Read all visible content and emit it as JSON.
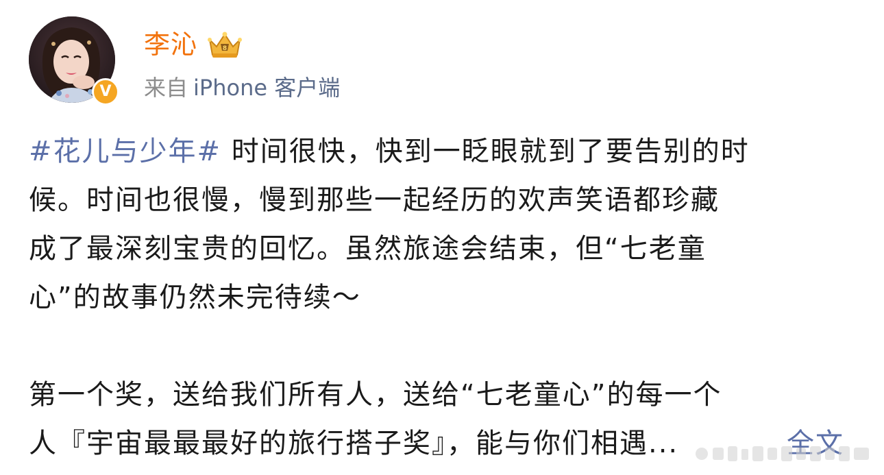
{
  "post": {
    "author": {
      "name": "李沁",
      "badge_icon": "crown-icon",
      "verified_icon": "verified-v-icon",
      "verified_color": "#f5a623",
      "name_color": "#f2720c"
    },
    "source": {
      "prefix": "来自",
      "device": "iPhone 客户端"
    },
    "paragraph1": {
      "hashtag": "#花儿与少年#",
      "line1_rest": " 时间很快，快到一眨眼就到了要告别的时",
      "line2": "候。时间也很慢，慢到那些一起经历的欢声笑语都珍藏",
      "line3": "成了最深刻宝贵的回忆。虽然旅途会结束，但“七老童",
      "line4": "心”的故事仍然未完待续～"
    },
    "paragraph2": {
      "line1": "第一个奖，送给我们所有人，送给“七老童心”的每一个",
      "line2": "人『宇宙最最最好的旅行搭子奖』，能与你们相遇..."
    },
    "full_text_link": "全文",
    "link_color": "#5b6fa8"
  }
}
